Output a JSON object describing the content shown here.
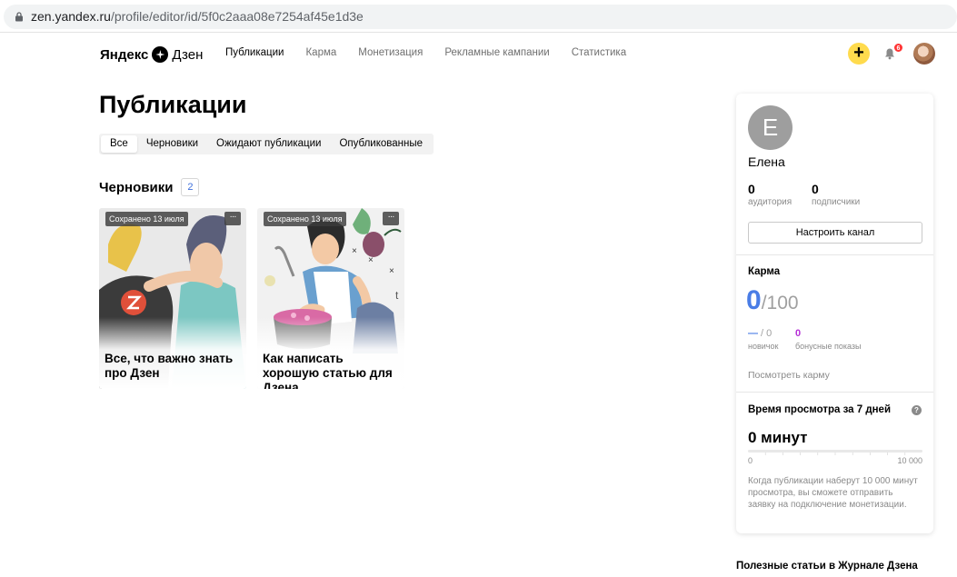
{
  "browser": {
    "url_host": "zen.yandex.ru",
    "url_path": "/profile/editor/id/5f0c2aaa08e7254af45e1d3e"
  },
  "header": {
    "logo_brand": "Яндекс",
    "logo_product": "Дзен",
    "nav": [
      {
        "label": "Публикации",
        "active": true
      },
      {
        "label": "Карма",
        "active": false
      },
      {
        "label": "Монетизация",
        "active": false
      },
      {
        "label": "Рекламные кампании",
        "active": false
      },
      {
        "label": "Статистика",
        "active": false
      }
    ],
    "add_label": "+",
    "notifications_count": "6",
    "accent_color": "#ffdb4d"
  },
  "main": {
    "title": "Публикации",
    "tabs": [
      {
        "label": "Все",
        "active": true
      },
      {
        "label": "Черновики",
        "active": false
      },
      {
        "label": "Ожидают публикации",
        "active": false
      },
      {
        "label": "Опубликованные",
        "active": false
      }
    ],
    "drafts_heading": "Черновики",
    "drafts_count": "2",
    "cards": [
      {
        "saved": "Сохранено 13 июля",
        "menu": "···",
        "title": "Все, что важно знать про Дзен",
        "image_icon": "two-people-illustration"
      },
      {
        "saved": "Сохранено 13 июля",
        "menu": "···",
        "title": "Как написать хорошую статью для Дзена",
        "image_icon": "cooking-woman-illustration"
      }
    ]
  },
  "profile": {
    "avatar_letter": "Е",
    "name": "Елена",
    "audience_value": "0",
    "audience_label": "аудитория",
    "subscribers_value": "0",
    "subscribers_label": "подписчики",
    "setup_button": "Настроить канал"
  },
  "karma": {
    "heading": "Карма",
    "value": "0",
    "max": "/100",
    "newbie_value": "—",
    "newbie_max": " / 0",
    "newbie_label": "новичок",
    "bonus_value": "0",
    "bonus_label": "бонусные показы",
    "link": "Посмотреть карму"
  },
  "watch_time": {
    "heading": "Время просмотра за 7 дней",
    "help": "?",
    "value": "0 минут",
    "progress": 0,
    "range_min": "0",
    "range_max": "10 000",
    "note": "Когда публикации наберут 10 000 минут просмотра, вы сможете отправить заявку на подключение монетизации."
  },
  "useful_heading": "Полезные статьи в Журнале Дзена"
}
